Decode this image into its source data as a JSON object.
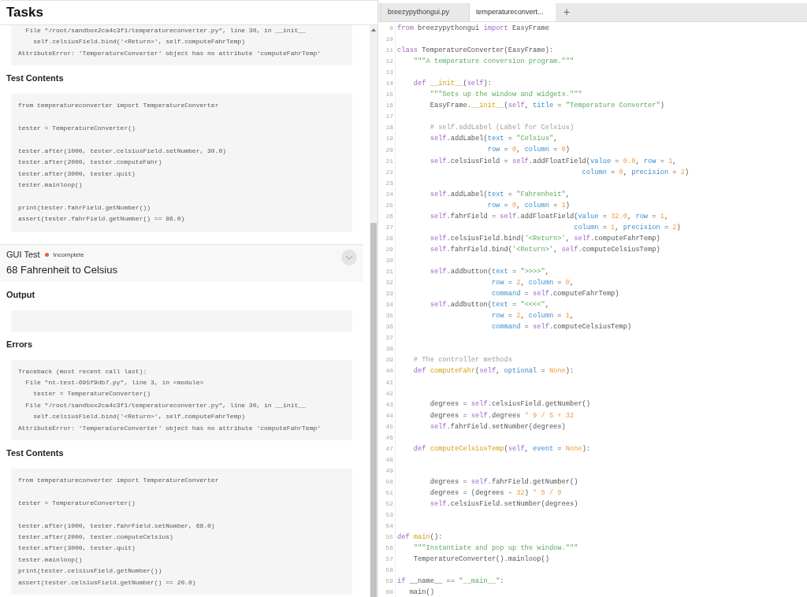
{
  "panel": {
    "title": "Tasks"
  },
  "sections": [
    {
      "kind": "code",
      "groups": [
        [
          "  File \"/root/sandbox2ca4c3f1/temperatureconverter.py\", line 30, in __init__",
          "    self.celsiusField.bind('<Return>', self.computeFahrTemp)",
          "AttributeError: 'TemperatureConverter' object has no attribute 'computeFahrTemp'"
        ]
      ]
    },
    {
      "kind": "heading",
      "text": "Test Contents"
    },
    {
      "kind": "code",
      "groups": [
        [
          "from temperatureconverter import TemperatureConverter"
        ],
        [
          "tester = TemperatureConverter()"
        ],
        [
          "tester.after(1000, tester.celsiusField.setNumber, 30.0)",
          "tester.after(2000, tester.computeFahr)",
          "tester.after(3000, tester.quit)",
          "tester.mainloop()"
        ],
        [
          "print(tester.fahrField.getNumber())",
          "assert(tester.fahrField.getNumber() == 86.0)"
        ]
      ]
    },
    {
      "kind": "test",
      "label": "GUI Test",
      "status": "Incomplete",
      "color": "#ef5350",
      "title": "68 Fahrenheit to Celsius"
    },
    {
      "kind": "heading",
      "text": "Output"
    },
    {
      "kind": "empty_box"
    },
    {
      "kind": "heading",
      "text": "Errors"
    },
    {
      "kind": "code",
      "groups": [
        [
          "Traceback (most recent call last):",
          "  File \"nt-test-695f9db7.py\", line 3, in <module>",
          "    tester = TemperatureConverter()",
          "  File \"/root/sandbox2ca4c3f1/temperatureconverter.py\", line 30, in __init__",
          "    self.celsiusField.bind('<Return>', self.computeFahrTemp)",
          "AttributeError: 'TemperatureConverter' object has no attribute 'computeFahrTemp'"
        ]
      ]
    },
    {
      "kind": "heading",
      "text": "Test Contents"
    },
    {
      "kind": "code",
      "groups": [
        [
          "from temperatureconverter import TemperatureConverter"
        ],
        [
          "tester = TemperatureConverter()"
        ],
        [
          "tester.after(1000, tester.fahrField.setNumber, 68.0)",
          "tester.after(2000, tester.computeCelsius)",
          "tester.after(3000, tester.quit)",
          "tester.mainloop()",
          "print(tester.celsiusField.getNumber())",
          "assert(tester.celsiusField.getNumber() == 20.0)"
        ]
      ]
    }
  ],
  "editor": {
    "tabs": [
      {
        "label": "breezypythongui.py",
        "selected": false
      },
      {
        "label": "temperatureconvert...",
        "selected": true
      }
    ],
    "new_tab": "+",
    "lines": [
      {
        "number": "9",
        "tokens": [
          {
            "kind": "kw",
            "text": "from"
          },
          {
            "kind": "t",
            "text": " breezypythongui "
          },
          {
            "kind": "kw",
            "text": "import"
          },
          {
            "kind": "t",
            "text": " EasyFrame"
          }
        ]
      },
      {
        "number": "10"
      },
      {
        "number": "11",
        "tokens": [
          {
            "kind": "kw",
            "text": "class"
          },
          {
            "kind": "t",
            "text": " TemperatureConverter(EasyFrame):"
          }
        ]
      },
      {
        "number": "12",
        "tokens": [
          {
            "kind": "s",
            "text": "    \"\"\"A temperature conversion program.\"\"\""
          }
        ]
      },
      {
        "number": "13"
      },
      {
        "number": "14",
        "tokens": [
          {
            "kind": "kw",
            "text": "    def"
          },
          {
            "kind": "fn",
            "text": " __init__"
          },
          {
            "kind": "t",
            "text": "("
          },
          {
            "kind": "self",
            "text": "self"
          },
          {
            "kind": "t",
            "text": "):"
          }
        ]
      },
      {
        "number": "15",
        "tokens": [
          {
            "kind": "s",
            "text": "        \"\"\"Sets up the window and widgets.\"\"\""
          }
        ]
      },
      {
        "number": "16",
        "tokens": [
          {
            "kind": "t",
            "text": "        EasyFrame."
          },
          {
            "kind": "fn",
            "text": "__init__"
          },
          {
            "kind": "t",
            "text": "("
          },
          {
            "kind": "self",
            "text": "self"
          },
          {
            "kind": "t",
            "text": ", "
          },
          {
            "kind": "p",
            "text": "title"
          },
          {
            "kind": "t",
            "text": " = "
          },
          {
            "kind": "s",
            "text": "\"Temperature Converter\""
          },
          {
            "kind": "t",
            "text": ")"
          }
        ]
      },
      {
        "number": "17"
      },
      {
        "number": "18",
        "tokens": [
          {
            "kind": "c",
            "text": "        # self.addLabel (Label for Celsius)"
          }
        ]
      },
      {
        "number": "19",
        "tokens": [
          {
            "kind": "self",
            "text": "        self"
          },
          {
            "kind": "t",
            "text": ".addLabel("
          },
          {
            "kind": "p",
            "text": "text"
          },
          {
            "kind": "t",
            "text": " = "
          },
          {
            "kind": "s",
            "text": "\"Celsius\""
          },
          {
            "kind": "t",
            "text": ","
          }
        ]
      },
      {
        "number": "20",
        "tokens": [
          {
            "kind": "p",
            "text": "                      row"
          },
          {
            "kind": "t",
            "text": " = "
          },
          {
            "kind": "n",
            "text": "0"
          },
          {
            "kind": "t",
            "text": ", "
          },
          {
            "kind": "p",
            "text": "column"
          },
          {
            "kind": "t",
            "text": " = "
          },
          {
            "kind": "n",
            "text": "0"
          },
          {
            "kind": "t",
            "text": ")"
          }
        ]
      },
      {
        "number": "21",
        "tokens": [
          {
            "kind": "self",
            "text": "        self"
          },
          {
            "kind": "t",
            "text": ".celsiusField = "
          },
          {
            "kind": "self",
            "text": "self"
          },
          {
            "kind": "t",
            "text": ".addFloatField("
          },
          {
            "kind": "p",
            "text": "value"
          },
          {
            "kind": "t",
            "text": " = "
          },
          {
            "kind": "n",
            "text": "0.0"
          },
          {
            "kind": "t",
            "text": ", "
          },
          {
            "kind": "p",
            "text": "row"
          },
          {
            "kind": "t",
            "text": " = "
          },
          {
            "kind": "n",
            "text": "1"
          },
          {
            "kind": "t",
            "text": ","
          }
        ]
      },
      {
        "number": "22",
        "tokens": [
          {
            "kind": "p",
            "text": "                                             column"
          },
          {
            "kind": "t",
            "text": " = "
          },
          {
            "kind": "n",
            "text": "0"
          },
          {
            "kind": "t",
            "text": ", "
          },
          {
            "kind": "p",
            "text": "precision"
          },
          {
            "kind": "t",
            "text": " = "
          },
          {
            "kind": "n",
            "text": "2"
          },
          {
            "kind": "t",
            "text": ")"
          }
        ]
      },
      {
        "number": "23"
      },
      {
        "number": "24",
        "tokens": [
          {
            "kind": "self",
            "text": "        self"
          },
          {
            "kind": "t",
            "text": ".addLabel("
          },
          {
            "kind": "p",
            "text": "text"
          },
          {
            "kind": "t",
            "text": " = "
          },
          {
            "kind": "s",
            "text": "\"Fahrenheit\""
          },
          {
            "kind": "t",
            "text": ","
          }
        ]
      },
      {
        "number": "25",
        "tokens": [
          {
            "kind": "p",
            "text": "                      row"
          },
          {
            "kind": "t",
            "text": " = "
          },
          {
            "kind": "n",
            "text": "0"
          },
          {
            "kind": "t",
            "text": ", "
          },
          {
            "kind": "p",
            "text": "column"
          },
          {
            "kind": "t",
            "text": " = "
          },
          {
            "kind": "n",
            "text": "1"
          },
          {
            "kind": "t",
            "text": ")"
          }
        ]
      },
      {
        "number": "26",
        "tokens": [
          {
            "kind": "self",
            "text": "        self"
          },
          {
            "kind": "t",
            "text": ".fahrField = "
          },
          {
            "kind": "self",
            "text": "self"
          },
          {
            "kind": "t",
            "text": ".addFloatField("
          },
          {
            "kind": "p",
            "text": "value"
          },
          {
            "kind": "t",
            "text": " = "
          },
          {
            "kind": "n",
            "text": "32.0"
          },
          {
            "kind": "t",
            "text": ", "
          },
          {
            "kind": "p",
            "text": "row"
          },
          {
            "kind": "t",
            "text": " = "
          },
          {
            "kind": "n",
            "text": "1"
          },
          {
            "kind": "t",
            "text": ","
          }
        ]
      },
      {
        "number": "27",
        "tokens": [
          {
            "kind": "p",
            "text": "                                           column"
          },
          {
            "kind": "t",
            "text": " = "
          },
          {
            "kind": "n",
            "text": "1"
          },
          {
            "kind": "t",
            "text": ", "
          },
          {
            "kind": "p",
            "text": "precision"
          },
          {
            "kind": "t",
            "text": " = "
          },
          {
            "kind": "n",
            "text": "2"
          },
          {
            "kind": "t",
            "text": ")"
          }
        ]
      },
      {
        "number": "28",
        "tokens": [
          {
            "kind": "self",
            "text": "        self"
          },
          {
            "kind": "t",
            "text": ".celsiusField.bind("
          },
          {
            "kind": "s",
            "text": "'<Return>'"
          },
          {
            "kind": "t",
            "text": ", "
          },
          {
            "kind": "self",
            "text": "self"
          },
          {
            "kind": "t",
            "text": ".computeFahrTemp)"
          }
        ]
      },
      {
        "number": "29",
        "tokens": [
          {
            "kind": "self",
            "text": "        self"
          },
          {
            "kind": "t",
            "text": ".fahrField.bind("
          },
          {
            "kind": "s",
            "text": "'<Return>'"
          },
          {
            "kind": "t",
            "text": ", "
          },
          {
            "kind": "self",
            "text": "self"
          },
          {
            "kind": "t",
            "text": ".computeCelsiusTemp)"
          }
        ]
      },
      {
        "number": "30"
      },
      {
        "number": "31",
        "tokens": [
          {
            "kind": "self",
            "text": "        self"
          },
          {
            "kind": "t",
            "text": ".addbutton("
          },
          {
            "kind": "p",
            "text": "text"
          },
          {
            "kind": "t",
            "text": " = "
          },
          {
            "kind": "s",
            "text": "\">>>>\""
          },
          {
            "kind": "t",
            "text": ","
          }
        ]
      },
      {
        "number": "32",
        "tokens": [
          {
            "kind": "p",
            "text": "                       row"
          },
          {
            "kind": "t",
            "text": " = "
          },
          {
            "kind": "n",
            "text": "2"
          },
          {
            "kind": "t",
            "text": ", "
          },
          {
            "kind": "p",
            "text": "column"
          },
          {
            "kind": "t",
            "text": " = "
          },
          {
            "kind": "n",
            "text": "0"
          },
          {
            "kind": "t",
            "text": ","
          }
        ]
      },
      {
        "number": "33",
        "tokens": [
          {
            "kind": "p",
            "text": "                       command"
          },
          {
            "kind": "t",
            "text": " = "
          },
          {
            "kind": "self",
            "text": "self"
          },
          {
            "kind": "t",
            "text": ".computeFahrTemp)"
          }
        ]
      },
      {
        "number": "34",
        "tokens": [
          {
            "kind": "self",
            "text": "        self"
          },
          {
            "kind": "t",
            "text": ".addbutton("
          },
          {
            "kind": "p",
            "text": "text"
          },
          {
            "kind": "t",
            "text": " = "
          },
          {
            "kind": "s",
            "text": "\"<<<<\""
          },
          {
            "kind": "t",
            "text": ","
          }
        ]
      },
      {
        "number": "35",
        "tokens": [
          {
            "kind": "p",
            "text": "                       row"
          },
          {
            "kind": "t",
            "text": " = "
          },
          {
            "kind": "n",
            "text": "2"
          },
          {
            "kind": "t",
            "text": ", "
          },
          {
            "kind": "p",
            "text": "column"
          },
          {
            "kind": "t",
            "text": " = "
          },
          {
            "kind": "n",
            "text": "1"
          },
          {
            "kind": "t",
            "text": ","
          }
        ]
      },
      {
        "number": "36",
        "tokens": [
          {
            "kind": "p",
            "text": "                       command"
          },
          {
            "kind": "t",
            "text": " = "
          },
          {
            "kind": "self",
            "text": "self"
          },
          {
            "kind": "t",
            "text": ".computeCelsiusTemp)"
          }
        ]
      },
      {
        "number": "37"
      },
      {
        "number": "38"
      },
      {
        "number": "39",
        "tokens": [
          {
            "kind": "c",
            "text": "    # The controller methods"
          }
        ]
      },
      {
        "number": "40",
        "tokens": [
          {
            "kind": "kw",
            "text": "    def"
          },
          {
            "kind": "fn",
            "text": " computeFahr"
          },
          {
            "kind": "t",
            "text": "("
          },
          {
            "kind": "self",
            "text": "self"
          },
          {
            "kind": "t",
            "text": ", "
          },
          {
            "kind": "p",
            "text": "optional"
          },
          {
            "kind": "t",
            "text": " = "
          },
          {
            "kind": "n",
            "text": "None"
          },
          {
            "kind": "t",
            "text": "):"
          }
        ]
      },
      {
        "number": "41"
      },
      {
        "number": "42"
      },
      {
        "number": "43",
        "tokens": [
          {
            "kind": "t",
            "text": "        degrees = "
          },
          {
            "kind": "self",
            "text": "self"
          },
          {
            "kind": "t",
            "text": ".celsiusField.getNumber()"
          }
        ]
      },
      {
        "number": "44",
        "tokens": [
          {
            "kind": "t",
            "text": "        degrees = "
          },
          {
            "kind": "self",
            "text": "self"
          },
          {
            "kind": "t",
            "text": ".degrees "
          },
          {
            "kind": "n",
            "text": "* 9 / 5 + 32"
          }
        ]
      },
      {
        "number": "45",
        "tokens": [
          {
            "kind": "self",
            "text": "        self"
          },
          {
            "kind": "t",
            "text": ".fahrField.setNumber(degrees)"
          }
        ]
      },
      {
        "number": "46"
      },
      {
        "number": "47",
        "tokens": [
          {
            "kind": "kw",
            "text": "    def"
          },
          {
            "kind": "fn",
            "text": " computeCelsiusTemp"
          },
          {
            "kind": "t",
            "text": "("
          },
          {
            "kind": "self",
            "text": "self"
          },
          {
            "kind": "t",
            "text": ", "
          },
          {
            "kind": "p",
            "text": "event"
          },
          {
            "kind": "t",
            "text": " = "
          },
          {
            "kind": "n",
            "text": "None"
          },
          {
            "kind": "t",
            "text": "):"
          }
        ]
      },
      {
        "number": "48"
      },
      {
        "number": "49"
      },
      {
        "number": "50",
        "tokens": [
          {
            "kind": "t",
            "text": "        degrees = "
          },
          {
            "kind": "self",
            "text": "self"
          },
          {
            "kind": "t",
            "text": ".fahrField.getNumber()"
          }
        ]
      },
      {
        "number": "51",
        "tokens": [
          {
            "kind": "t",
            "text": "        degrees = (degrees - "
          },
          {
            "kind": "n",
            "text": "32"
          },
          {
            "kind": "t",
            "text": ") "
          },
          {
            "kind": "n",
            "text": "* 5 / 9"
          }
        ]
      },
      {
        "number": "52",
        "tokens": [
          {
            "kind": "self",
            "text": "        self"
          },
          {
            "kind": "t",
            "text": ".celsiusField.setNumber(degrees)"
          }
        ]
      },
      {
        "number": "53"
      },
      {
        "number": "54"
      },
      {
        "number": "55",
        "tokens": [
          {
            "kind": "kw",
            "text": "def"
          },
          {
            "kind": "fn",
            "text": " main"
          },
          {
            "kind": "t",
            "text": "():"
          }
        ]
      },
      {
        "number": "56",
        "tokens": [
          {
            "kind": "s",
            "text": "    \"\"\"Instantiate and pop up the window.\"\"\""
          }
        ]
      },
      {
        "number": "57",
        "tokens": [
          {
            "kind": "t",
            "text": "    TemperatureConverter().mainloop()"
          }
        ]
      },
      {
        "number": "58"
      },
      {
        "number": "59",
        "tokens": [
          {
            "kind": "kw",
            "text": "if"
          },
          {
            "kind": "t",
            "text": " __name__ == "
          },
          {
            "kind": "s",
            "text": "\"__main__\""
          },
          {
            "kind": "t",
            "text": ":"
          }
        ]
      },
      {
        "number": "60",
        "tokens": [
          {
            "kind": "t",
            "text": "   main()"
          }
        ]
      }
    ]
  }
}
